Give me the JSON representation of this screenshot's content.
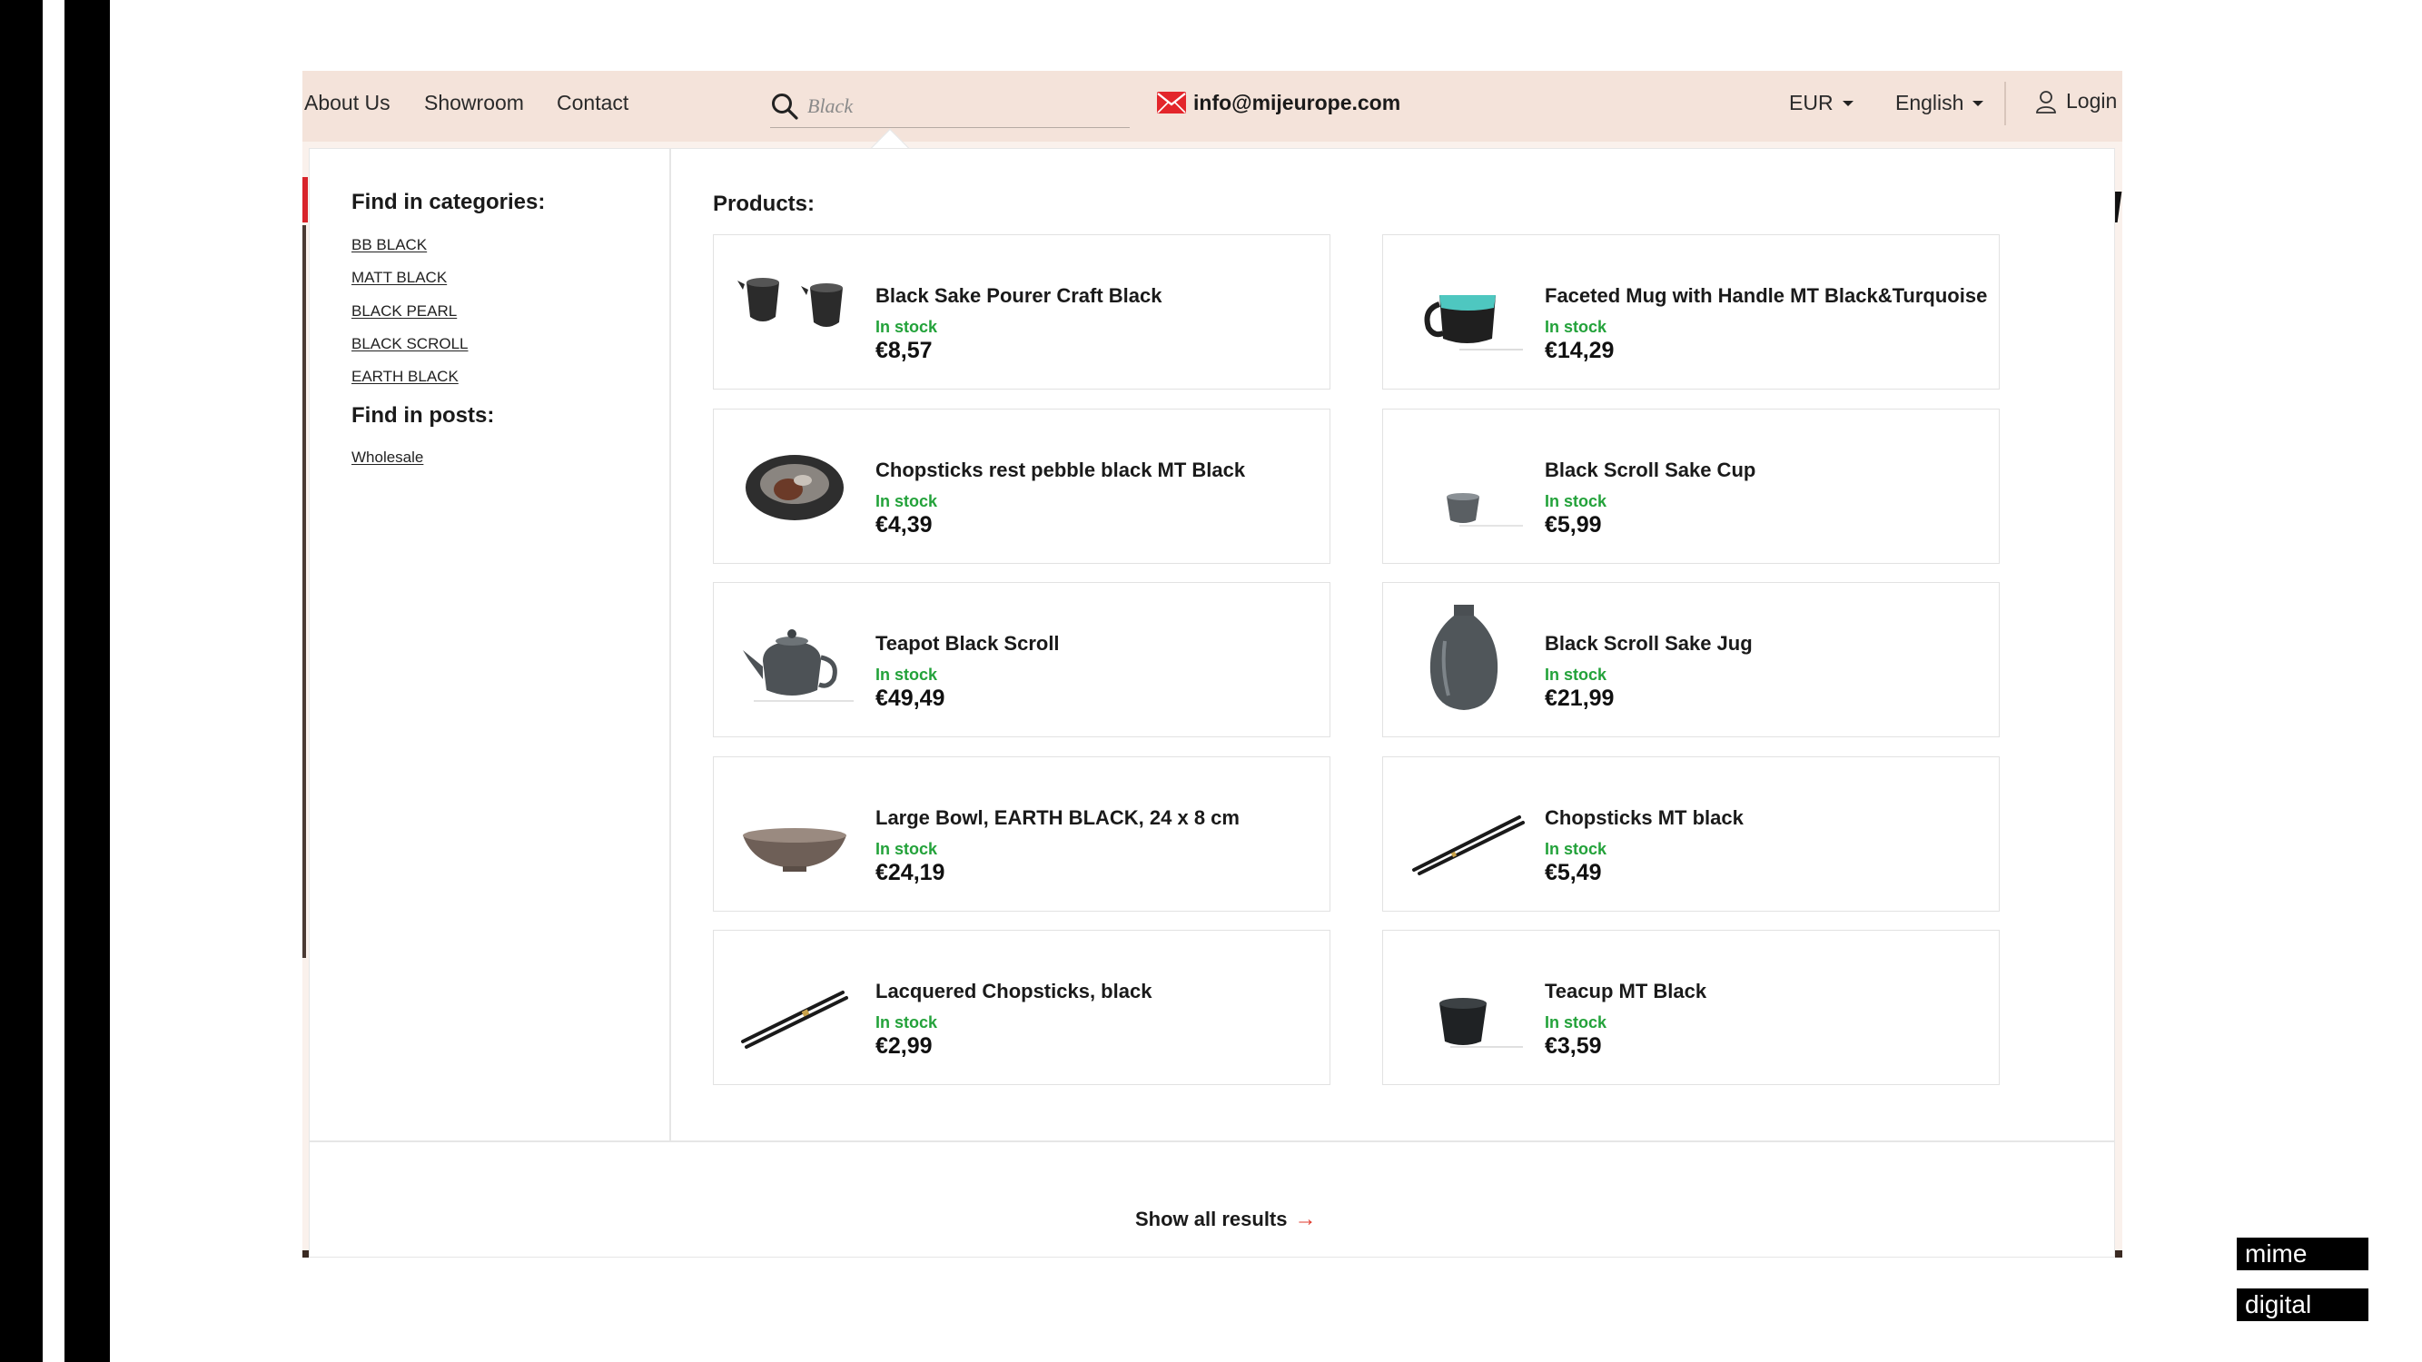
{
  "header": {
    "nav": [
      "About Us",
      "Showroom",
      "Contact"
    ],
    "search": {
      "value": "",
      "placeholder": "Black",
      "icon": "search-icon"
    },
    "email": {
      "text": "info@mijeurope.com",
      "icon": "envelope-icon",
      "icon_color": "#e3262b"
    },
    "currency": {
      "label": "EUR"
    },
    "language": {
      "label": "English"
    },
    "login": {
      "label": "Login",
      "icon": "user-icon"
    }
  },
  "sidebar": {
    "categories_heading": "Find in categories:",
    "categories": [
      "BB BLACK",
      "MATT BLACK",
      "BLACK PEARL",
      "BLACK SCROLL",
      "EARTH BLACK"
    ],
    "posts_heading": "Find in posts:",
    "posts": [
      "Wholesale"
    ]
  },
  "products": {
    "heading": "Products:",
    "items": [
      {
        "name": "Black Sake Pourer Craft Black",
        "stock": "In stock",
        "price": "€8,57",
        "thumb": "sake-pourer-image"
      },
      {
        "name": "Faceted Mug with Handle MT Black&Turquoise",
        "stock": "In stock",
        "price": "€14,29",
        "thumb": "mug-image"
      },
      {
        "name": "Chopsticks rest pebble black MT Black",
        "stock": "In stock",
        "price": "€4,39",
        "thumb": "chopstick-rest-image"
      },
      {
        "name": "Black Scroll Sake Cup",
        "stock": "In stock",
        "price": "€5,99",
        "thumb": "sake-cup-image"
      },
      {
        "name": "Teapot Black Scroll",
        "stock": "In stock",
        "price": "€49,49",
        "thumb": "teapot-image"
      },
      {
        "name": "Black Scroll Sake Jug",
        "stock": "In stock",
        "price": "€21,99",
        "thumb": "sake-jug-image"
      },
      {
        "name": "Large Bowl, EARTH BLACK, 24 x 8 cm",
        "stock": "In stock",
        "price": "€24,19",
        "thumb": "bowl-image"
      },
      {
        "name": "Chopsticks MT black",
        "stock": "In stock",
        "price": "€5,49",
        "thumb": "chopsticks-image"
      },
      {
        "name": "Lacquered Chopsticks, black",
        "stock": "In stock",
        "price": "€2,99",
        "thumb": "lacquered-chopsticks-image"
      },
      {
        "name": "Teacup MT Black",
        "stock": "In stock",
        "price": "€3,59",
        "thumb": "teacup-image"
      }
    ]
  },
  "footer": {
    "show_all": "Show all results",
    "arrow": "→"
  },
  "brand": {
    "line1": "mime",
    "line2": "digital"
  },
  "colors": {
    "stock_green": "#23a23a",
    "accent_red": "#e03a2c",
    "topbar": "#f4e3da"
  }
}
